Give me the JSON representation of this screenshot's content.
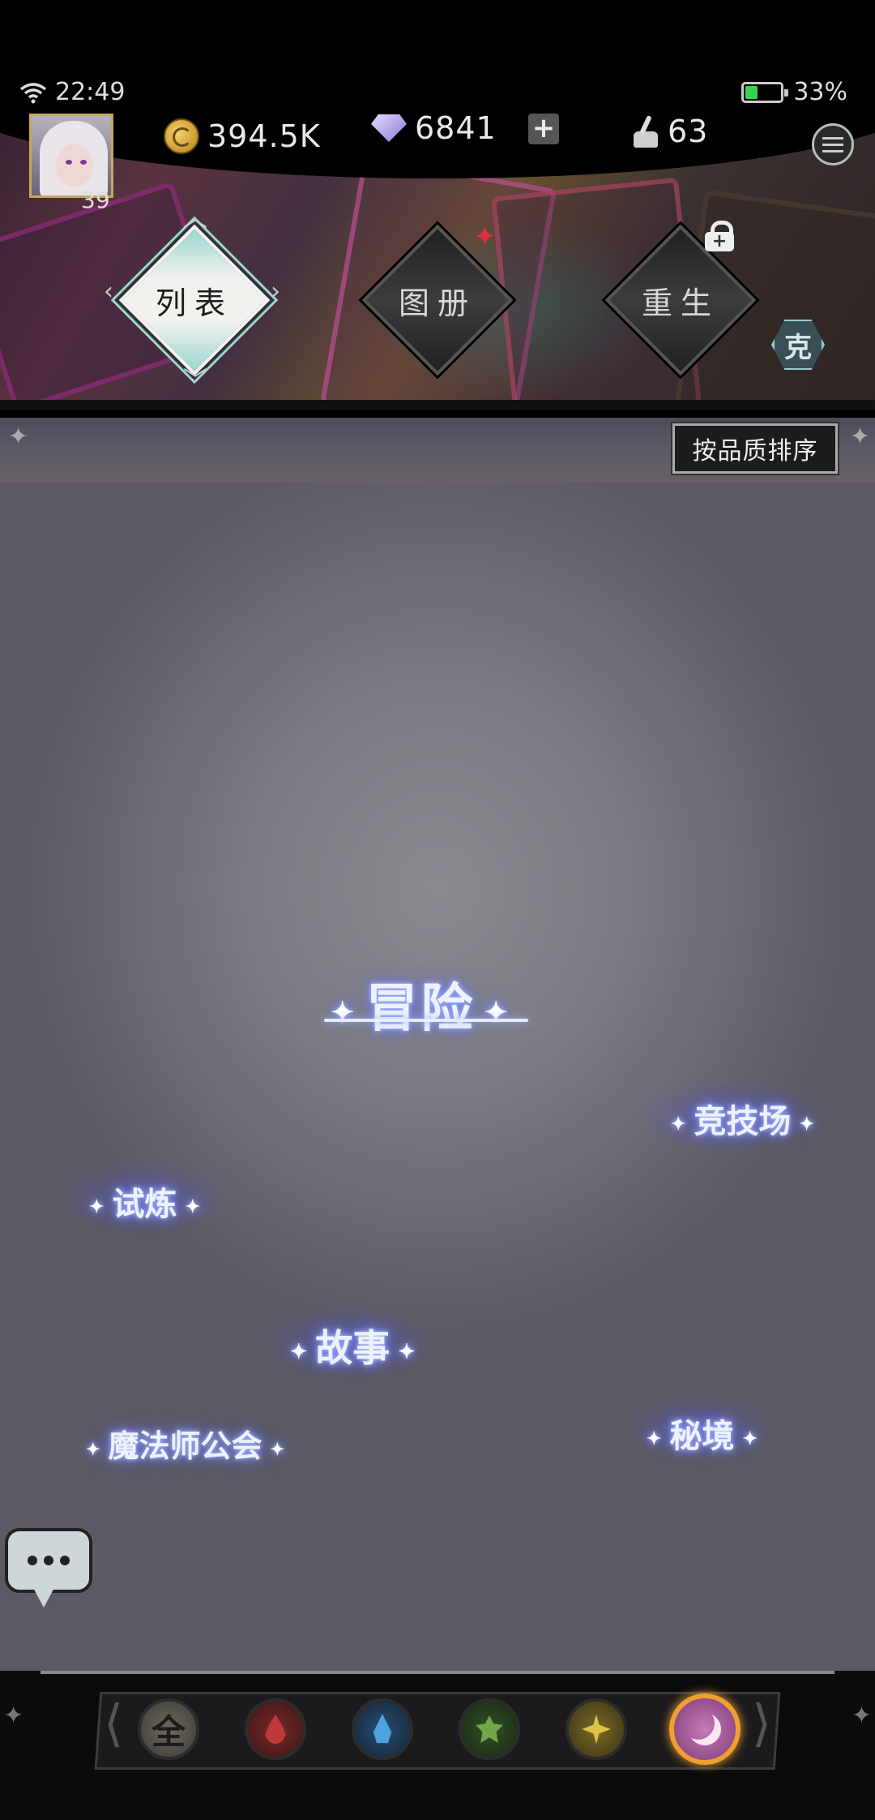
{
  "status": {
    "time": "22:49",
    "battery": "33%",
    "battery_level": 0.33
  },
  "player": {
    "level": "39"
  },
  "currencies": {
    "gold": "394.5K",
    "gems": "6841",
    "ink": "63"
  },
  "icons": {
    "wifi": "wifi-icon",
    "battery": "battery-icon",
    "gold": "gold-coin-icon",
    "gem": "gem-icon",
    "plus": "plus-icon",
    "ink": "ink-bottle-icon",
    "menu": "menu-icon",
    "lock": "lock-icon",
    "chat": "chat-icon"
  },
  "tabs": [
    {
      "label": "列表",
      "selected": true
    },
    {
      "label": "图册",
      "selected": false,
      "badge": "red-star"
    },
    {
      "label": "重生",
      "selected": false,
      "locked": true
    }
  ],
  "ke_badge": "克",
  "sort_button": "按品质排序",
  "locations": {
    "adventure": "冒险",
    "arena": "竞技场",
    "trial": "试炼",
    "story": "故事",
    "guild": "魔法师公会",
    "secret": "秘境"
  },
  "filters": [
    {
      "name": "all",
      "label": "全"
    },
    {
      "name": "fire"
    },
    {
      "name": "water"
    },
    {
      "name": "earth"
    },
    {
      "name": "light"
    },
    {
      "name": "dark",
      "selected": true
    }
  ],
  "colors": {
    "selected_tab_accent": "#9bd6cf",
    "location_glow": "#7f8fff",
    "selected_filter_ring": "#f0a030",
    "notification_star": "#e0303a"
  }
}
